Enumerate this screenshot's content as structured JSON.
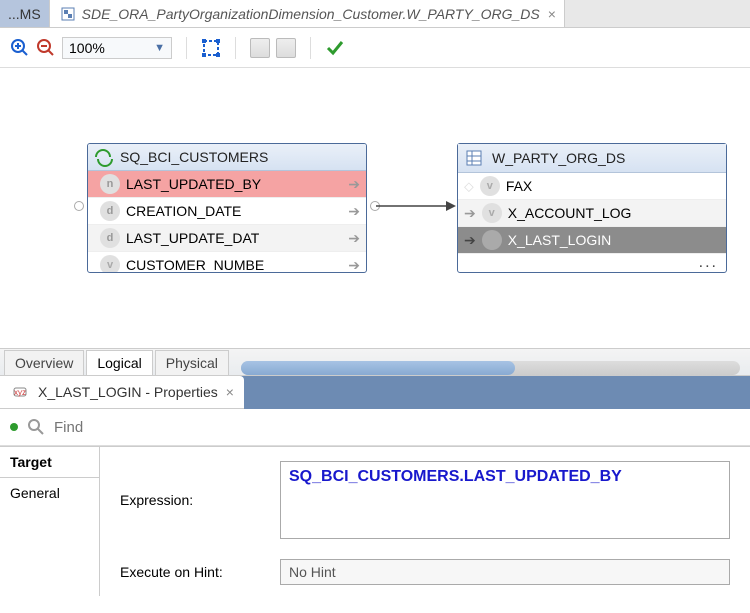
{
  "tabs": {
    "prev_label": "...MS",
    "active_label": "SDE_ORA_PartyOrganizationDimension_Customer.W_PARTY_ORG_DS"
  },
  "toolbar": {
    "zoom_value": "100%"
  },
  "canvas": {
    "source": {
      "title": "SQ_BCI_CUSTOMERS",
      "rows": [
        {
          "name": "LAST_UPDATED_BY",
          "kind": "n",
          "sel": true
        },
        {
          "name": "CREATION_DATE",
          "kind": "d"
        },
        {
          "name": "LAST_UPDATE_DAT",
          "kind": "d"
        },
        {
          "name": "CUSTOMER_NUMBE",
          "kind": "v"
        }
      ]
    },
    "target": {
      "title": "W_PARTY_ORG_DS",
      "rows": [
        {
          "name": "FAX",
          "kind": "v"
        },
        {
          "name": "X_ACCOUNT_LOG",
          "kind": "v"
        },
        {
          "name": "X_LAST_LOGIN",
          "kind": "v",
          "sel": true
        }
      ],
      "more": "..."
    }
  },
  "sub_tabs": {
    "items": [
      "Overview",
      "Logical",
      "Physical"
    ],
    "active": "Logical"
  },
  "properties": {
    "panel_title": "X_LAST_LOGIN - Properties",
    "find_placeholder": "Find",
    "side": {
      "target": "Target",
      "general": "General"
    },
    "expression_label": "Expression:",
    "expression_value": "SQ_BCI_CUSTOMERS.LAST_UPDATED_BY",
    "hint_label": "Execute on Hint:",
    "hint_value": "No Hint"
  }
}
